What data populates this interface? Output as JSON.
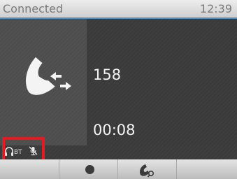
{
  "status_bar": {
    "state": "Connected",
    "time": "12:39"
  },
  "call": {
    "number": "158",
    "duration": "00:08",
    "icon": "handset-transfer-icon"
  },
  "indicators": {
    "headset": "headset-icon",
    "bt_label": "BT",
    "mic": "mic-muted-icon",
    "highlight_color": "#e31b23"
  },
  "softkeys": [
    {
      "icon": "none"
    },
    {
      "icon": "record-dot-icon"
    },
    {
      "icon": "handset-search-icon"
    },
    {
      "icon": "none"
    }
  ],
  "colors": {
    "status_accent": "#4a90c8",
    "text": "#f4f4f4"
  }
}
